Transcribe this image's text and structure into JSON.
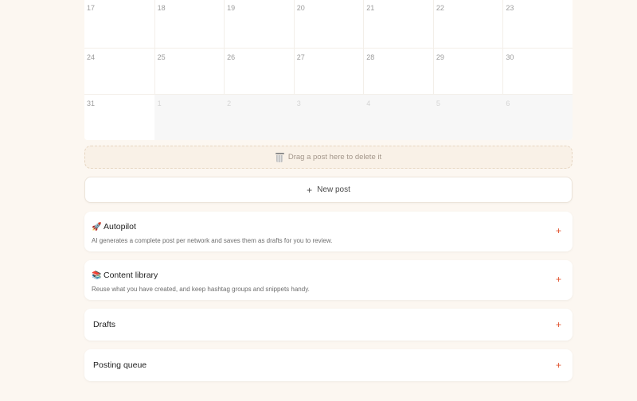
{
  "calendar": {
    "rows": [
      [
        {
          "n": "17"
        },
        {
          "n": "18"
        },
        {
          "n": "19"
        },
        {
          "n": "20"
        },
        {
          "n": "21"
        },
        {
          "n": "22"
        },
        {
          "n": "23"
        }
      ],
      [
        {
          "n": "24"
        },
        {
          "n": "25"
        },
        {
          "n": "26"
        },
        {
          "n": "27"
        },
        {
          "n": "28"
        },
        {
          "n": "29"
        },
        {
          "n": "30"
        }
      ],
      [
        {
          "n": "31"
        },
        {
          "n": "1"
        },
        {
          "n": "2"
        },
        {
          "n": "3"
        },
        {
          "n": "4"
        },
        {
          "n": "5"
        },
        {
          "n": "6"
        }
      ]
    ]
  },
  "trash": {
    "label": "Drag a post here to delete it",
    "icon": "trash-icon"
  },
  "new_post": {
    "label": "New post",
    "icon": "plus-icon"
  },
  "panels": {
    "autopilot": {
      "title": "Autopilot",
      "icon": "rocket-icon",
      "desc": "AI generates a complete post per network and saves them as drafts for you to review."
    },
    "library": {
      "title": "Content library",
      "icon": "books-icon",
      "desc": "Reuse what you have created, and keep hashtag groups and snippets handy."
    },
    "drafts": {
      "title": "Drafts"
    },
    "queue": {
      "title": "Posting queue"
    }
  },
  "colors": {
    "accent": "#e0502b",
    "background": "#fcf7f1"
  }
}
